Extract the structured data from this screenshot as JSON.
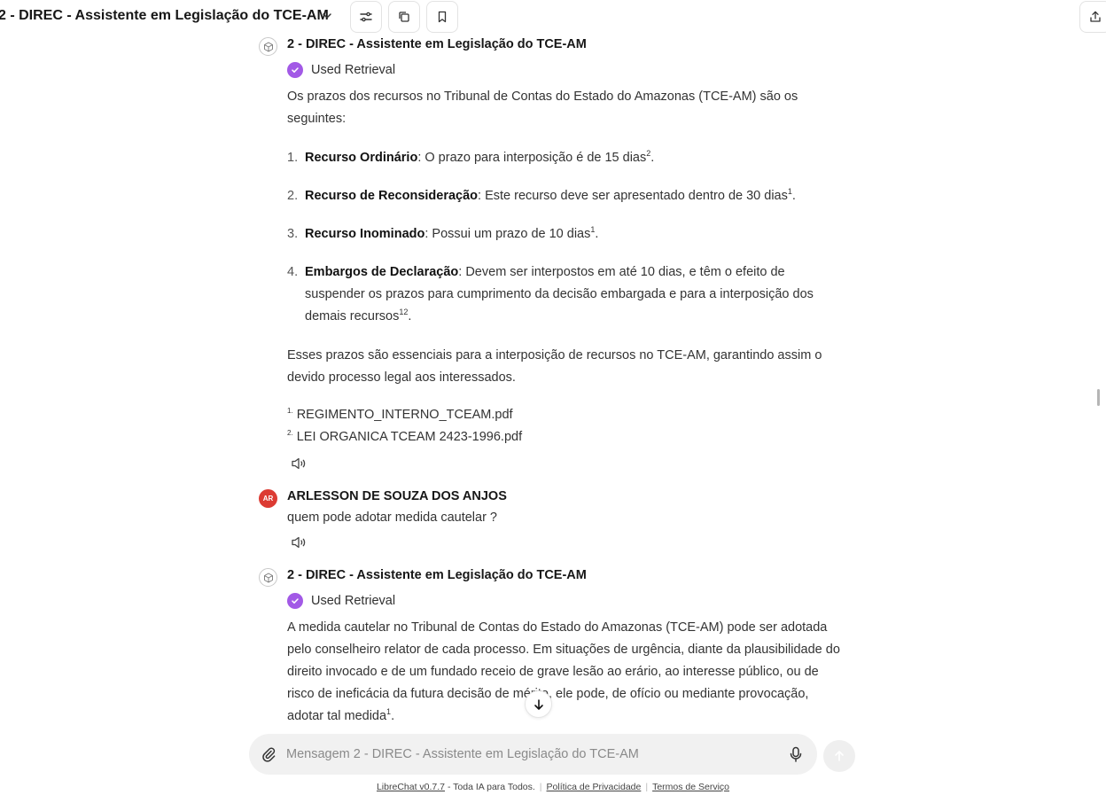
{
  "header": {
    "model_title": "2 - DIREC - Assistente em Legislação do TCE-AM"
  },
  "messages": [
    {
      "sender": "2 - DIREC - Assistente em Legislação do TCE-AM",
      "tool": "Used Retrieval",
      "intro": "Os prazos dos recursos no Tribunal de Contas do Estado do Amazonas (TCE-AM) são os seguintes:",
      "items": [
        {
          "num": "1.",
          "title": "Recurso Ordinário",
          "text": ": O prazo para interposição é de 15 dias",
          "sup": "2",
          "end": "."
        },
        {
          "num": "2.",
          "title": "Recurso de Reconsideração",
          "text": ": Este recurso deve ser apresentado dentro de 30 dias",
          "sup": "1",
          "end": "."
        },
        {
          "num": "3.",
          "title": "Recurso Inominado",
          "text": ": Possui um prazo de 10 dias",
          "sup": "1",
          "end": "."
        },
        {
          "num": "4.",
          "title": "Embargos de Declaração",
          "text": ": Devem ser interpostos em até 10 dias, e têm o efeito de suspender os prazos para cumprimento da decisão embargada e para a interposição dos demais recursos",
          "sup": "12",
          "end": "."
        }
      ],
      "outro": "Esses prazos são essenciais para a interposição de recursos no TCE-AM, garantindo assim o devido processo legal aos interessados.",
      "citations": [
        {
          "num": "1.",
          "file": "REGIMENTO_INTERNO_TCEAM.pdf"
        },
        {
          "num": "2.",
          "file": "LEI ORGANICA TCEAM 2423-1996.pdf"
        }
      ]
    },
    {
      "sender": "ARLESSON DE SOUZA DOS ANJOS",
      "initials": "AR",
      "text": "quem pode adotar medida cautelar ?"
    },
    {
      "sender": "2 - DIREC - Assistente em Legislação do TCE-AM",
      "tool": "Used Retrieval",
      "answer": "A medida cautelar no Tribunal de Contas do Estado do Amazonas (TCE-AM) pode ser adotada pelo conselheiro relator de cada processo. Em situações de urgência, diante da plausibilidade do direito invocado e de um fundado receio de grave lesão ao erário, ao interesse público, ou de risco de ineficácia da futura decisão de mérito, ele pode, de ofício ou mediante provocação, adotar tal medida",
      "sup": "1",
      "end": "."
    }
  ],
  "composer": {
    "placeholder": "Mensagem 2 - DIREC - Assistente em Legislação do TCE-AM"
  },
  "footer": {
    "version_link": "LibreChat v0.7.7",
    "tagline": " - Toda IA para Todos.",
    "privacy": "Política de Privacidade",
    "terms": "Termos de Serviço"
  },
  "icons": {
    "bot_avatar": "cube-icon",
    "check": "check-circle-icon",
    "speaker": "speaker-icon",
    "attach": "paperclip-icon",
    "mic": "microphone-icon",
    "send": "arrow-up-icon"
  },
  "colors": {
    "accent_purple": "#a259e6",
    "user_avatar": "#dc3b33",
    "composer_bg": "#f1f1f1"
  }
}
